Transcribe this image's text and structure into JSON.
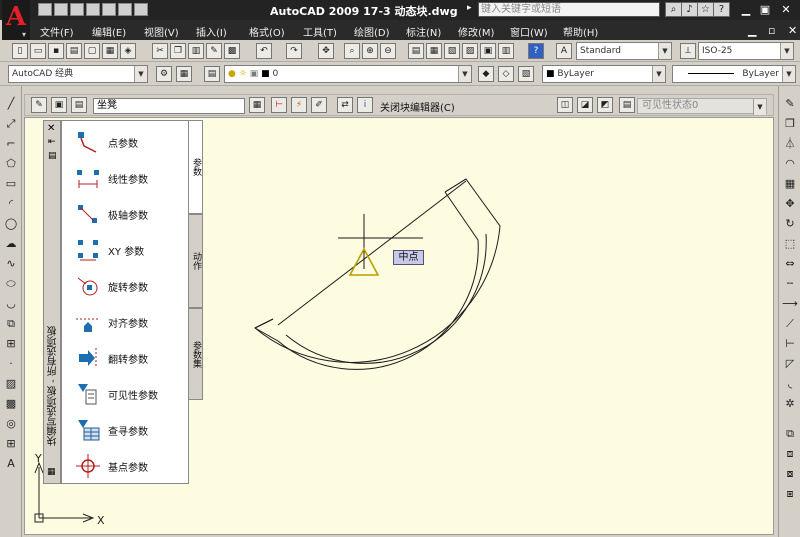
{
  "app": {
    "title": "AutoCAD 2009  17-3 动态块.dwg",
    "search_placeholder": "键入关键字或短语",
    "logo": "A"
  },
  "menu": [
    "文件(F)",
    "编辑(E)",
    "视图(V)",
    "插入(I)",
    "格式(O)",
    "工具(T)",
    "绘图(D)",
    "标注(N)",
    "修改(M)",
    "窗口(W)",
    "帮助(H)"
  ],
  "toolbar1": {
    "text_style": "Standard",
    "dim_style": "ISO-25"
  },
  "toolbar2": {
    "workspace": "AutoCAD 经典",
    "layer": "0",
    "color": "ByLayer",
    "linetype": "ByLayer"
  },
  "block_editor": {
    "name_value": "坐凳",
    "close_label": "关闭块编辑器(C)",
    "visibility_state": "可见性状态0"
  },
  "palette": {
    "title": "块编写选项板 - 所有选项板",
    "items": [
      {
        "label": "点参数"
      },
      {
        "label": "线性参数"
      },
      {
        "label": "极轴参数"
      },
      {
        "label": "XY 参数"
      },
      {
        "label": "旋转参数"
      },
      {
        "label": "对齐参数"
      },
      {
        "label": "翻转参数"
      },
      {
        "label": "可见性参数"
      },
      {
        "label": "查寻参数"
      },
      {
        "label": "基点参数"
      }
    ],
    "tabs": [
      "参数",
      "动作",
      "参数集"
    ]
  },
  "canvas": {
    "tooltip": "中点",
    "ucs_x": "X",
    "ucs_y": "Y"
  },
  "colors": {
    "canvas_bg": "#fdfbe0",
    "title_bg": "#232323",
    "accent_red": "#e0202a"
  }
}
